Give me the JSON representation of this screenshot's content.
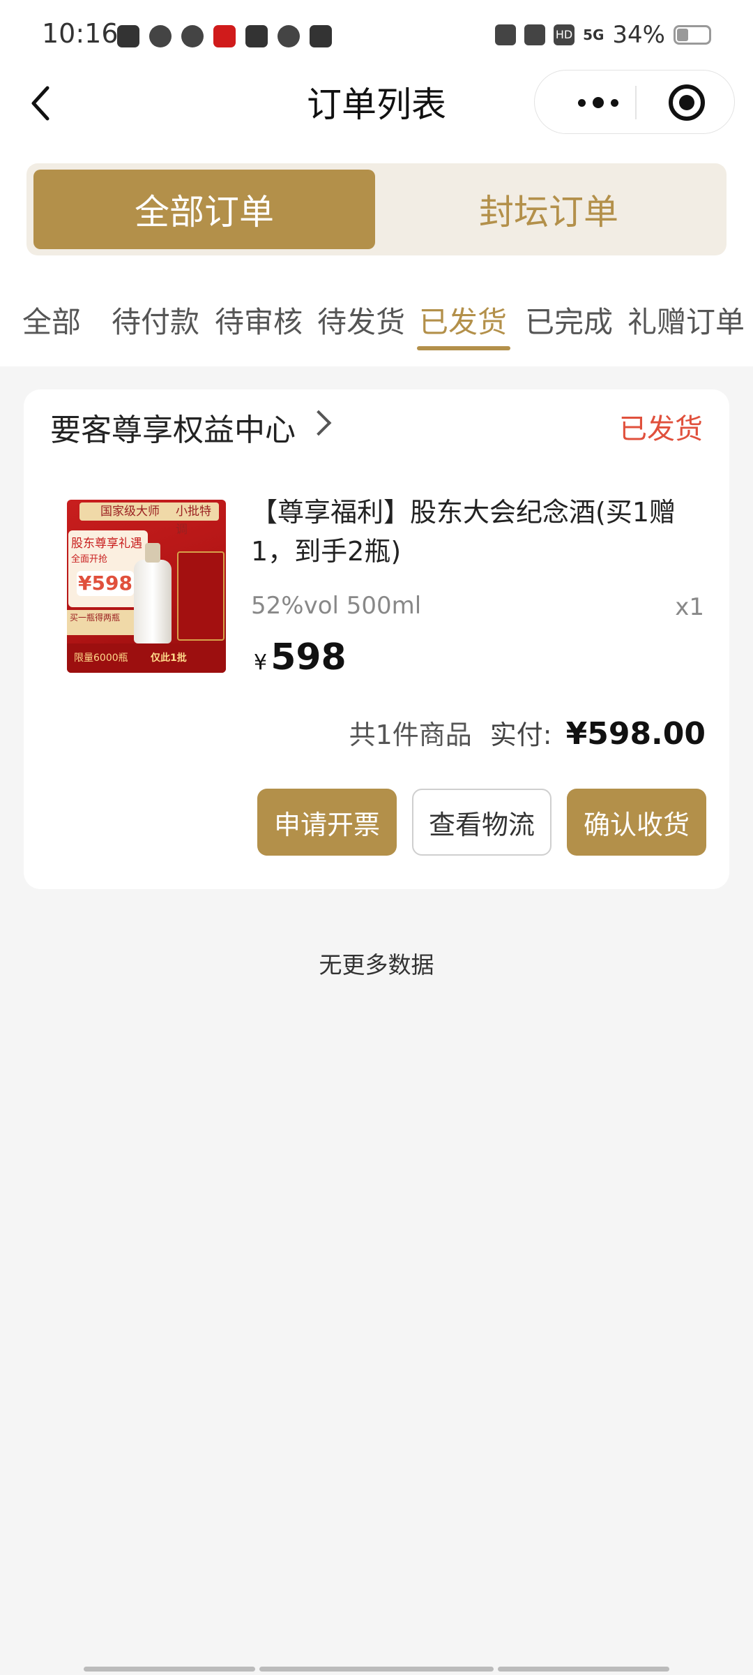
{
  "status_bar": {
    "time": "10:16",
    "network": "5G",
    "hd_label": "HD",
    "battery_percent": "34%",
    "battery_level": 0.34,
    "left_icons": [
      "app-icon",
      "shield-icon",
      "du-icon",
      "red-app-icon",
      "play-icon",
      "send-icon",
      "calendar-icon"
    ],
    "right_icons": [
      "alarm-icon",
      "vibrate-icon",
      "hd-icon",
      "signal-icon",
      "battery-icon"
    ]
  },
  "header": {
    "title": "订单列表",
    "back_icon": "chevron-left-icon",
    "more_icon": "more-dots-icon",
    "close_icon": "target-icon"
  },
  "segment": {
    "active": "全部订单",
    "inactive": "封坛订单"
  },
  "status_tabs": {
    "items": [
      "全部",
      "待付款",
      "待审核",
      "待发货",
      "已发货",
      "已完成",
      "礼赠订单"
    ],
    "active_index": 4
  },
  "order": {
    "shop_name": "要客尊享权益中心",
    "status": "已发货",
    "product": {
      "title": "【尊享福利】股东大会纪念酒(买1赠1，到手2瓶)",
      "spec": "52%vol 500ml",
      "quantity": "x1",
      "price_symbol": "¥",
      "price": "598",
      "image_text": {
        "banner_left": "国家级大师",
        "banner_right": "小批特调",
        "headline": "股东尊享礼遇",
        "subline": "全面开抢",
        "price_label": "¥598",
        "offer": "买一瓶得两瓶",
        "footer_a": "限量6000瓶",
        "footer_b": "仅此1批"
      }
    },
    "summary": {
      "count_text": "共1件商品",
      "paid_label": "实付:",
      "paid_amount": "¥598.00"
    },
    "actions": {
      "invoice": "申请开票",
      "logistics": "查看物流",
      "confirm": "确认收货"
    }
  },
  "footer": {
    "no_more": "无更多数据"
  },
  "colors": {
    "accent": "#b3904a",
    "segment_bg": "#f2ede4",
    "status_red": "#e0503c",
    "page_bg": "#f5f5f5"
  }
}
